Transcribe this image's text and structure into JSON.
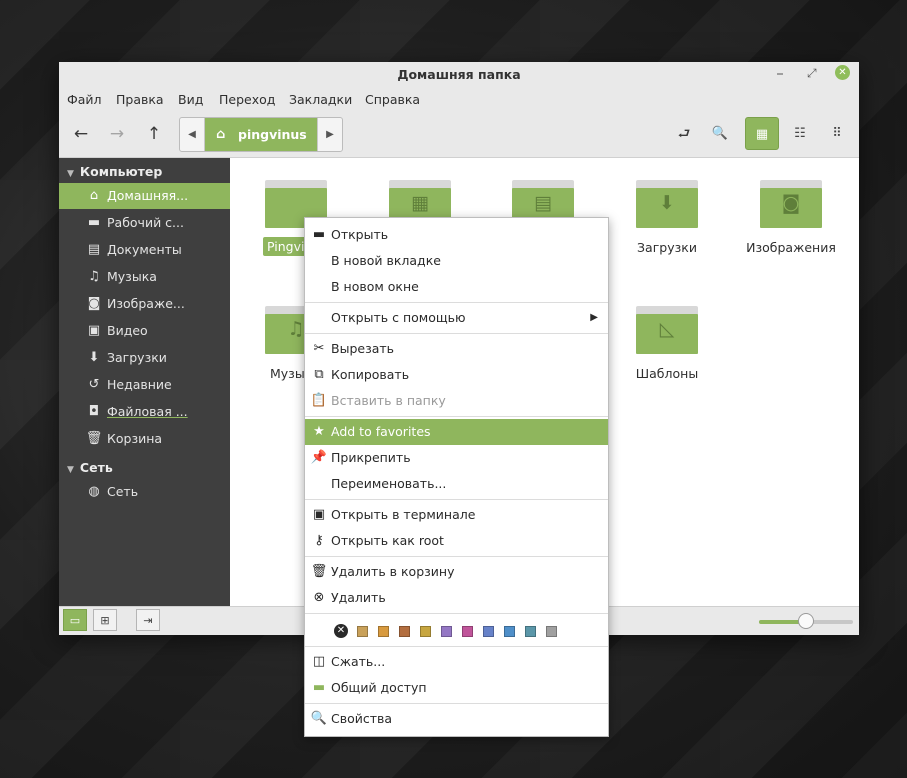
{
  "window": {
    "title": "Домашняя папка",
    "minimize": "⎯",
    "maximize": "⤢",
    "close": "✕"
  },
  "menubar": [
    "Файл",
    "Правка",
    "Вид",
    "Переход",
    "Закладки",
    "Справка"
  ],
  "toolbar": {
    "back_icon": "←",
    "forward_icon": "→",
    "up_icon": "↑",
    "path_left": "◀",
    "path_right": "▶",
    "path_icon": "⌂",
    "path_label": "pingvinus",
    "toggle_icon": "⮐",
    "search_icon": "🔍",
    "icon_view": "▦",
    "list_view": "☷",
    "compact_view": "⠿"
  },
  "sidebar": {
    "computer_label": "Компьютер",
    "network_label": "Сеть",
    "items": [
      {
        "icon": "⌂",
        "label": "Домашняя..."
      },
      {
        "icon": "▬",
        "label": "Рабочий с..."
      },
      {
        "icon": "▤",
        "label": "Документы"
      },
      {
        "icon": "♫",
        "label": "Музыка"
      },
      {
        "icon": "◙",
        "label": "Изображе..."
      },
      {
        "icon": "▣",
        "label": "Видео"
      },
      {
        "icon": "⬇",
        "label": "Загрузки"
      },
      {
        "icon": "↺",
        "label": "Недавние"
      },
      {
        "icon": "◘",
        "label": "Файловая ..."
      },
      {
        "icon": "🗑",
        "label": "Корзина"
      }
    ],
    "network_items": [
      {
        "icon": "◍",
        "label": "Сеть"
      }
    ]
  },
  "files": [
    {
      "label": "Pingvi",
      "emblem": ""
    },
    {
      "label": "",
      "emblem": "▦"
    },
    {
      "label": "",
      "emblem": "▤"
    },
    {
      "label": "Загрузки",
      "emblem": "⬇"
    },
    {
      "label": "Изображения",
      "emblem": "◙"
    },
    {
      "label": "Музы",
      "emblem": "♫"
    },
    {
      "label": "Шаблоны",
      "emblem": "◺"
    }
  ],
  "statusbar": {
    "places_icon": "▭",
    "tree_icon": "⊞",
    "close_sidebar_icon": "⇥",
    "zoom_level": 0.5
  },
  "context_menu": {
    "items": [
      {
        "icon": "▬",
        "label": "Открыть"
      },
      {
        "icon": "",
        "label": "В новой вкладке"
      },
      {
        "icon": "",
        "label": "В новом окне"
      },
      {
        "icon": "",
        "label": "Открыть с помощью",
        "submenu": "▶"
      },
      {
        "icon": "✂",
        "label": "Вырезать"
      },
      {
        "icon": "⧉",
        "label": "Копировать"
      },
      {
        "icon": "📋",
        "label": "Вставить в папку"
      },
      {
        "icon": "★",
        "label": "Add to favorites"
      },
      {
        "icon": "📌",
        "label": "Прикрепить"
      },
      {
        "icon": "",
        "label": "Переименовать..."
      },
      {
        "icon": "▣",
        "label": "Открыть в терминале"
      },
      {
        "icon": "⚷",
        "label": "Открыть как root"
      },
      {
        "icon": "🗑",
        "label": "Удалить в корзину"
      },
      {
        "icon": "⊗",
        "label": "Удалить"
      },
      {
        "icon": "◫",
        "label": "Сжать..."
      },
      {
        "icon": "▬",
        "label": "Общий доступ"
      },
      {
        "icon": "🔍",
        "label": "Свойства"
      }
    ],
    "swatch_clear_icon": "✕",
    "swatches": [
      "#c9a15a",
      "#d89a3e",
      "#b36e3f",
      "#c7a640",
      "#9477c4",
      "#c0559a",
      "#6782c9",
      "#4f8fc9",
      "#5b97a9",
      "#a0a0a0"
    ]
  }
}
